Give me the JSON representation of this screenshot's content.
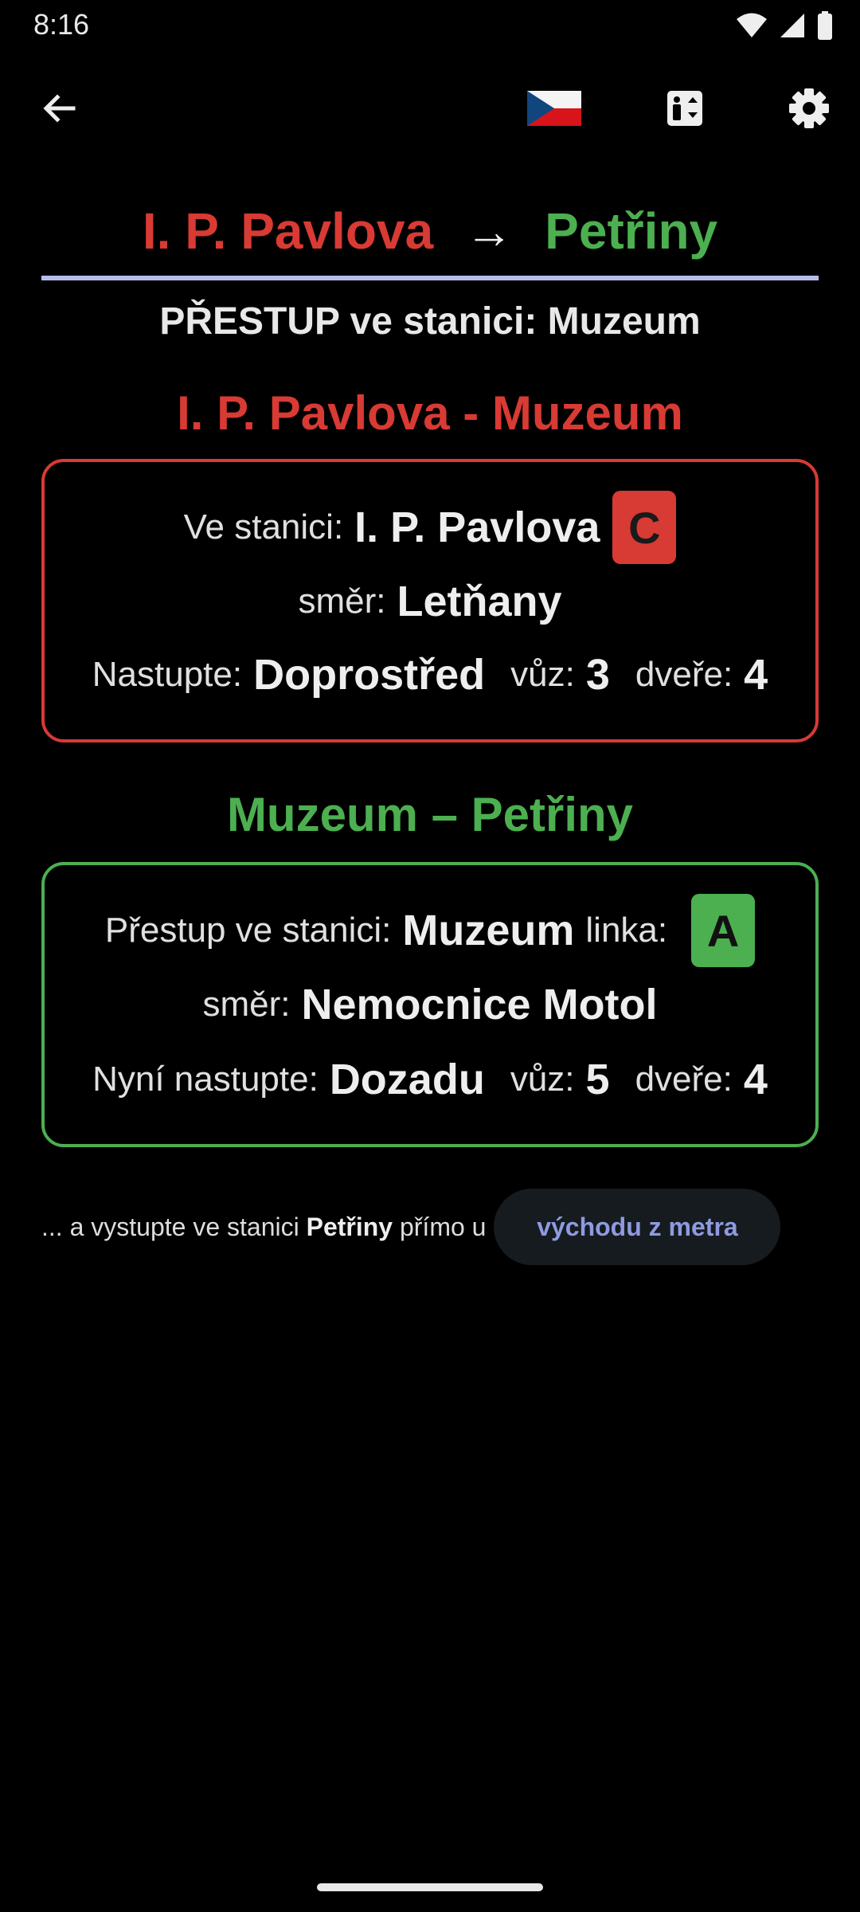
{
  "status_bar": {
    "time": "8:16"
  },
  "app_bar": {
    "icons": [
      "back-arrow-icon",
      "czech-flag-icon",
      "elevator-icon",
      "gear-icon"
    ]
  },
  "route": {
    "from": "I. P. Pavlova",
    "arrow": "→",
    "to": "Petřiny",
    "transfer_text": "PŘESTUP ve stanici: Muzeum"
  },
  "colors": {
    "line_c": "#d83a34",
    "line_a": "#4caf50",
    "divider": "#b7bde8",
    "exit_button_text": "#8f9ae0",
    "background": "#000000"
  },
  "segment1": {
    "title": "I. P. Pavlova - Muzeum",
    "station_label": "Ve stanici:",
    "station": "I. P. Pavlova",
    "line": "C",
    "direction_label": "směr:",
    "direction": "Letňany",
    "board_label": "Nastupte:",
    "board": "Doprostřed",
    "car_label": "vůz:",
    "car": "3",
    "door_label": "dveře:",
    "door": "4"
  },
  "segment2": {
    "title": "Muzeum – Petřiny",
    "station_label": "Přestup ve stanici:",
    "station": "Muzeum",
    "line_label": "linka:",
    "line": "A",
    "direction_label": "směr:",
    "direction": "Nemocnice Motol",
    "board_label": "Nyní nastupte:",
    "board": "Dozadu",
    "car_label": "vůz:",
    "car": "5",
    "door_label": "dveře:",
    "door": "4"
  },
  "exit_info": {
    "prefix": "... a vystupte ve stanici",
    "station": "Petřiny",
    "suffix": "přímo u",
    "button_label": "východu z metra"
  }
}
